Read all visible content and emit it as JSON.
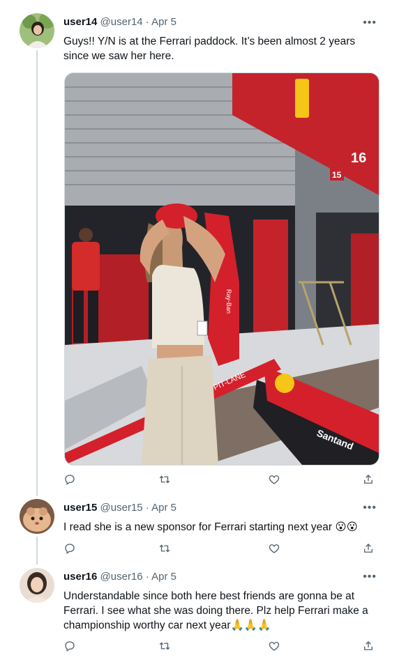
{
  "tweets": [
    {
      "name": "user14",
      "handle": "@user14",
      "separator": "·",
      "date": "Apr 5",
      "more": "•••",
      "text": "Guys!! Y/N is at the Ferrari paddock. It’s been almost 2 years since we saw her here."
    },
    {
      "name": "user15",
      "handle": "@user15",
      "separator": "·",
      "date": "Apr 5",
      "more": "•••",
      "text": "I read she is a new sponsor for Ferrari starting next year",
      "emoji": "😮😮"
    },
    {
      "name": "user16",
      "handle": "@user16",
      "separator": "·",
      "date": "Apr 5",
      "more": "•••",
      "text": "Understandable since both here best friends are gonna be at Ferrari. I see what she was doing there. Plz help Ferrari make a championship worthy car next year",
      "emoji": "🙏🙏🙏"
    }
  ],
  "photo": {
    "garage_number": "15",
    "sign_number": "16",
    "pit_lane_text": "PIT-LANE",
    "santander_text": "Santand",
    "sponsor_text": "Ray-Ban"
  },
  "icons": [
    "reply-icon",
    "retweet-icon",
    "like-icon",
    "share-icon",
    "more-icon"
  ],
  "colors": {
    "text": "#0f1419",
    "secondary": "#536471",
    "line": "#cfd9de",
    "ferrari_red": "#d4202b"
  }
}
